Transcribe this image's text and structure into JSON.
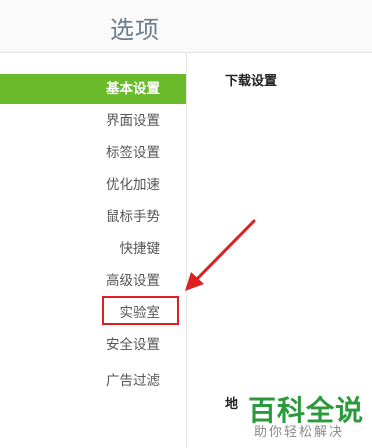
{
  "header": {
    "title": "选项"
  },
  "sidebar": {
    "items": [
      {
        "label": "基本设置",
        "active": true
      },
      {
        "label": "界面设置"
      },
      {
        "label": "标签设置"
      },
      {
        "label": "优化加速"
      },
      {
        "label": "鼠标手势"
      },
      {
        "label": "快捷键"
      },
      {
        "label": "高级设置"
      },
      {
        "label": "实验室"
      },
      {
        "label": "安全设置"
      },
      {
        "label": "广告过滤"
      }
    ]
  },
  "content": {
    "section_title": "下载设置",
    "partial_text": "地"
  },
  "annotation": {
    "highlight_color": "#e02020",
    "arrow_color": "#e02020"
  },
  "watermark": {
    "brand": "百科全说",
    "slogan": "助你轻松解决"
  },
  "colors": {
    "accent": "#6aba2b"
  }
}
